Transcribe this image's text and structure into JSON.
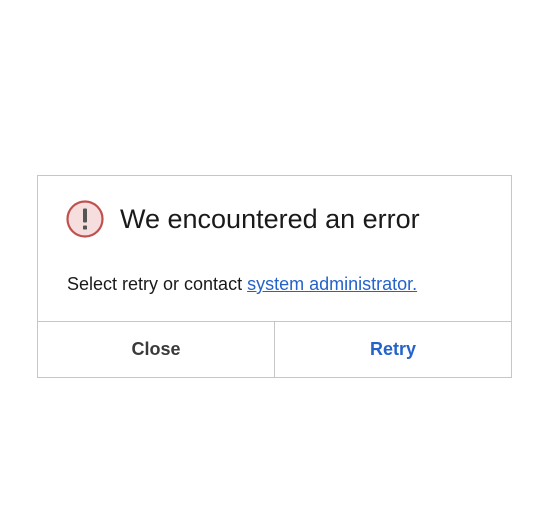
{
  "dialog": {
    "title": "We encountered an error",
    "message_prefix": "Select retry or contact ",
    "message_link": "system administrator.",
    "icon": "alert-exclamation-icon",
    "icon_color": "#c0504d",
    "icon_fill": "#f6dede",
    "link_color": "#2563c9",
    "buttons": {
      "close_label": "Close",
      "retry_label": "Retry"
    }
  }
}
